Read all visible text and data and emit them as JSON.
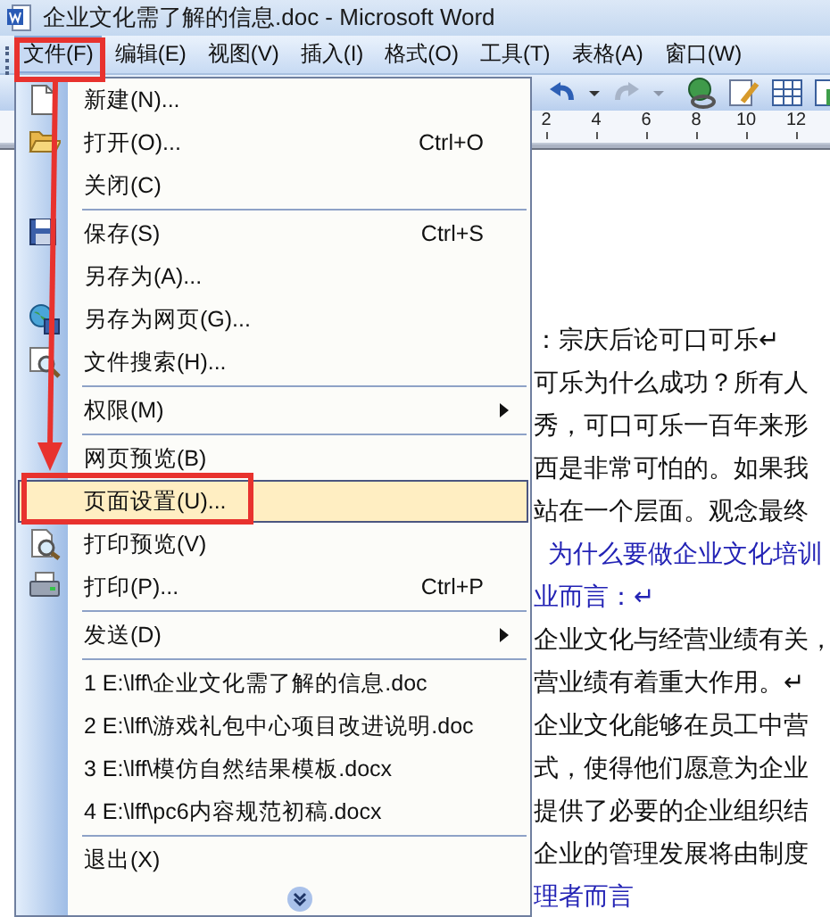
{
  "window": {
    "title": "企业文化需了解的信息.doc - Microsoft Word"
  },
  "menubar": {
    "items": [
      {
        "label": "文件(F)",
        "selected": true
      },
      {
        "label": "编辑(E)",
        "selected": false
      },
      {
        "label": "视图(V)",
        "selected": false
      },
      {
        "label": "插入(I)",
        "selected": false
      },
      {
        "label": "格式(O)",
        "selected": false
      },
      {
        "label": "工具(T)",
        "selected": false
      },
      {
        "label": "表格(A)",
        "selected": false
      },
      {
        "label": "窗口(W)",
        "selected": false
      }
    ]
  },
  "ruler": {
    "ticks": [
      "2",
      "4",
      "6",
      "8",
      "10",
      "12"
    ]
  },
  "file_menu": {
    "items": [
      {
        "kind": "item",
        "label": "新建(N)...",
        "selected": false,
        "submenu": false
      },
      {
        "kind": "item",
        "label": "打开(O)...",
        "shortcut": "Ctrl+O",
        "selected": false,
        "submenu": false
      },
      {
        "kind": "item",
        "label": "关闭(C)",
        "selected": false,
        "submenu": false
      },
      {
        "kind": "separator"
      },
      {
        "kind": "item",
        "label": "保存(S)",
        "shortcut": "Ctrl+S",
        "selected": false,
        "submenu": false
      },
      {
        "kind": "item",
        "label": "另存为(A)...",
        "selected": false,
        "submenu": false
      },
      {
        "kind": "item",
        "label": "另存为网页(G)...",
        "selected": false,
        "submenu": false
      },
      {
        "kind": "item",
        "label": "文件搜索(H)...",
        "selected": false,
        "submenu": false
      },
      {
        "kind": "separator"
      },
      {
        "kind": "item",
        "label": "权限(M)",
        "selected": false,
        "submenu": true
      },
      {
        "kind": "separator"
      },
      {
        "kind": "item",
        "label": "网页预览(B)",
        "selected": false,
        "submenu": false
      },
      {
        "kind": "item",
        "label": "页面设置(U)...",
        "selected": true,
        "submenu": false
      },
      {
        "kind": "item",
        "label": "打印预览(V)",
        "selected": false,
        "submenu": false
      },
      {
        "kind": "item",
        "label": "打印(P)...",
        "shortcut": "Ctrl+P",
        "selected": false,
        "submenu": false
      },
      {
        "kind": "separator"
      },
      {
        "kind": "item",
        "label": "发送(D)",
        "selected": false,
        "submenu": true
      },
      {
        "kind": "separator"
      },
      {
        "kind": "item",
        "label": "1 E:\\lff\\企业文化需了解的信息.doc",
        "selected": false,
        "submenu": false
      },
      {
        "kind": "item",
        "label": "2 E:\\lff\\游戏礼包中心项目改进说明.doc",
        "selected": false,
        "submenu": false
      },
      {
        "kind": "item",
        "label": "3 E:\\lff\\模仿自然结果模板.docx",
        "selected": false,
        "submenu": false
      },
      {
        "kind": "item",
        "label": "4 E:\\lff\\pc6内容规范初稿.docx",
        "selected": false,
        "submenu": false
      },
      {
        "kind": "separator"
      },
      {
        "kind": "item",
        "label": "退出(X)",
        "selected": false,
        "submenu": false
      }
    ]
  },
  "document": {
    "lines": [
      {
        "kind": "body",
        "text": "：宗庆后论可口可乐↵"
      },
      {
        "kind": "body",
        "text": "可乐为什么成功？所有人"
      },
      {
        "kind": "body",
        "text": "秀，可口可乐一百年来形"
      },
      {
        "kind": "body",
        "text": "西是非常可怕的。如果我"
      },
      {
        "kind": "body",
        "text": "站在一个层面。观念最终"
      },
      {
        "kind": "heading",
        "text": "为什么要做企业文化培训"
      },
      {
        "kind": "link",
        "text": "业而言：↵"
      },
      {
        "kind": "body",
        "text": "企业文化与经营业绩有关，"
      },
      {
        "kind": "body",
        "text": "营业绩有着重大作用。↵"
      },
      {
        "kind": "body",
        "text": "企业文化能够在员工中营"
      },
      {
        "kind": "body",
        "text": "式，使得他们愿意为企业"
      },
      {
        "kind": "body",
        "text": "提供了必要的企业组织结"
      },
      {
        "kind": "body",
        "text": "企业的管理发展将由制度"
      },
      {
        "kind": "link",
        "text": "理者而言"
      }
    ]
  }
}
